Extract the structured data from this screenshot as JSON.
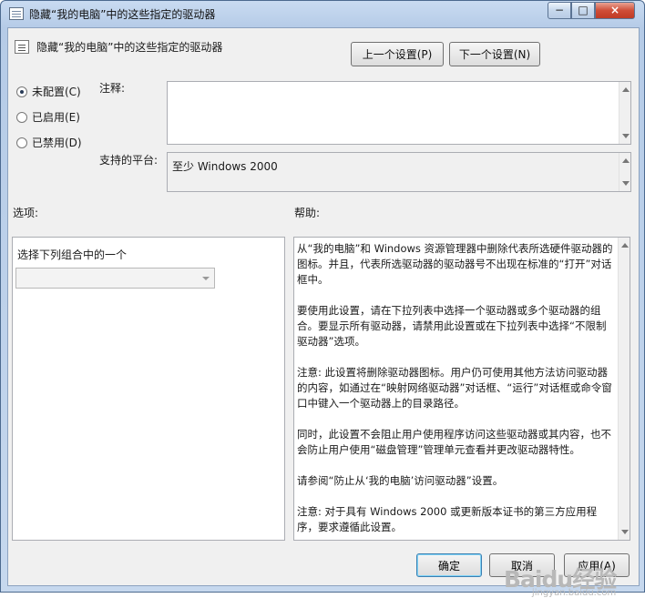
{
  "window": {
    "title": "隐藏“我的电脑”中的这些指定的驱动器",
    "controls": [
      "−",
      "□",
      "×"
    ]
  },
  "header": {
    "setting_name": "隐藏“我的电脑”中的这些指定的驱动器",
    "prev_button": "上一个设置(P)",
    "next_button": "下一个设置(N)"
  },
  "state": {
    "options": [
      {
        "label": "未配置(C)",
        "selected": true
      },
      {
        "label": "已启用(E)",
        "selected": false
      },
      {
        "label": "已禁用(D)",
        "selected": false
      }
    ],
    "comment_label": "注释:",
    "comment_value": "",
    "platform_label": "支持的平台:",
    "platform_value": "至少 Windows 2000"
  },
  "options_section": {
    "title": "选项:",
    "dropdown_label": "选择下列组合中的一个",
    "dropdown_value": ""
  },
  "help_section": {
    "title": "帮助:",
    "paragraphs": [
      "从“我的电脑”和 Windows 资源管理器中删除代表所选硬件驱动器的图标。并且，代表所选驱动器的驱动器号不出现在标准的“打开”对话框中。",
      "要使用此设置，请在下拉列表中选择一个驱动器或多个驱动器的组合。要显示所有驱动器，请禁用此设置或在下拉列表中选择“不限制驱动器”选项。",
      "注意: 此设置将删除驱动器图标。用户仍可使用其他方法访问驱动器的内容，如通过在“映射网络驱动器”对话框、“运行”对话框或命令窗口中键入一个驱动器上的目录路径。",
      "同时，此设置不会阻止用户使用程序访问这些驱动器或其内容，也不会防止用户使用“磁盘管理”管理单元查看并更改驱动器特性。",
      "请参阅“防止从‘我的电脑’访问驱动器”设置。",
      "注意: 对于具有 Windows 2000 或更新版本证书的第三方应用程序，要求遵循此设置。"
    ]
  },
  "footer": {
    "ok": "确定",
    "cancel": "取消",
    "apply": "应用(A)"
  },
  "watermark": {
    "text": "Baidu经验",
    "url": "jingyan.baidu.com"
  }
}
